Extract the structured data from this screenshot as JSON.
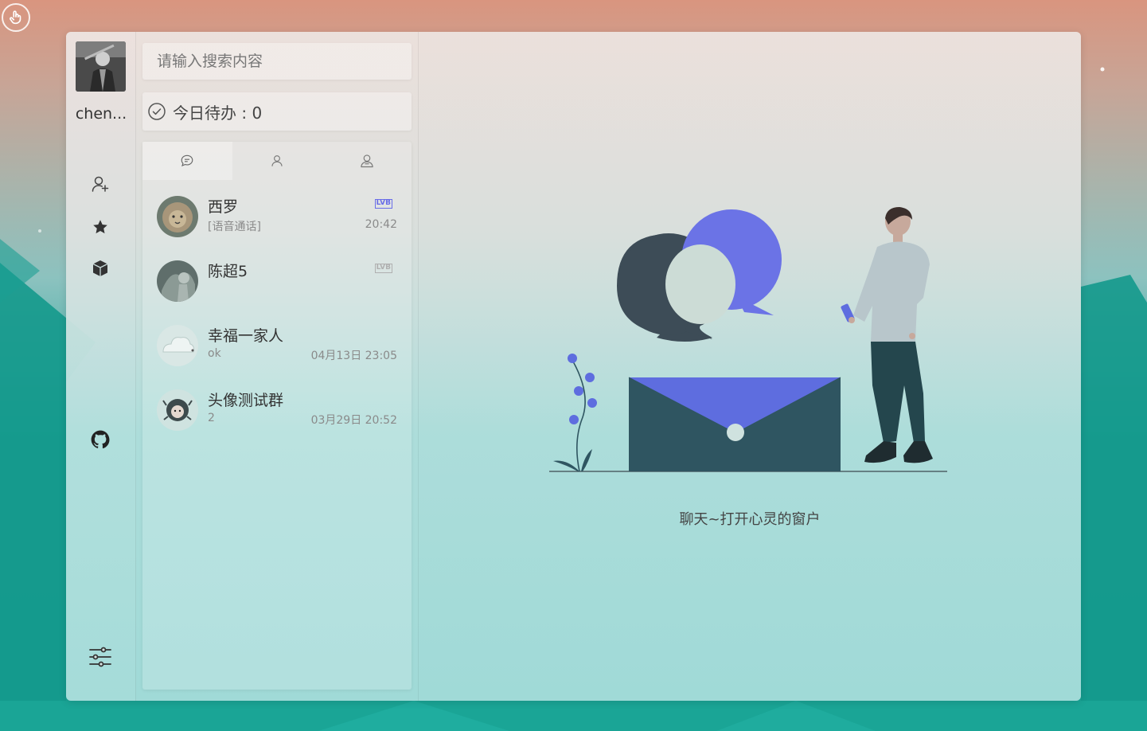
{
  "user": {
    "name": "chen..."
  },
  "search": {
    "placeholder": "请输入搜索内容"
  },
  "todo": {
    "label": "今日待办 : 0"
  },
  "tabs": [
    {
      "icon": "chat-bubble-icon",
      "active": true
    },
    {
      "icon": "user-icon",
      "active": false
    },
    {
      "icon": "group-icon",
      "active": false
    }
  ],
  "conversations": [
    {
      "name": "西罗",
      "message": "[语音通话]",
      "time": "20:42",
      "tag": "LVB"
    },
    {
      "name": "陈超5",
      "message": "",
      "time": "",
      "tag": "LVB"
    },
    {
      "name": "幸福一家人",
      "message": "ok",
      "time": "04月13日 23:05",
      "tag": ""
    },
    {
      "name": "头像测试群",
      "message": "2",
      "time": "03月29日 20:52",
      "tag": ""
    }
  ],
  "main": {
    "slogan": "聊天~打开心灵的窗户"
  },
  "colors": {
    "accent": "#6a6ee8",
    "dark_teal": "#2f5561",
    "teal_bg": "#23a79c"
  }
}
